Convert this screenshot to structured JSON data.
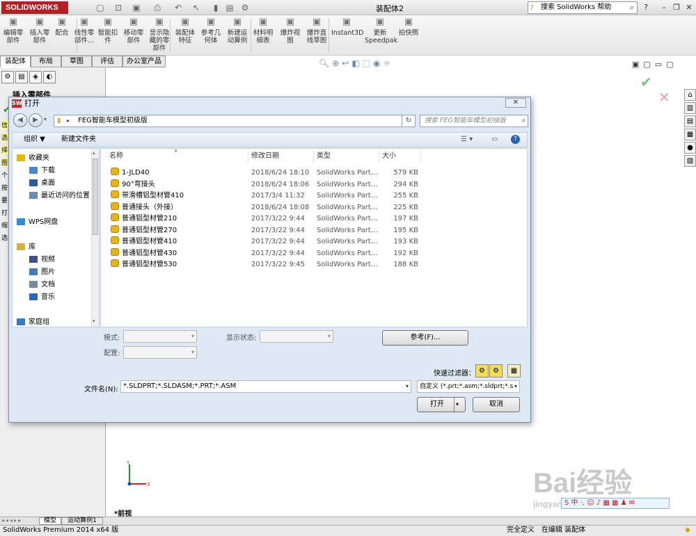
{
  "app": {
    "logo": "SOLIDWORKS",
    "document_title": "装配体2",
    "help_search_placeholder": "搜索 SolidWorks 帮助"
  },
  "ribbon": {
    "buttons": [
      {
        "label": "编辑零\n部件",
        "icon": "edit-component-icon"
      },
      {
        "label": "插入零\n部件",
        "icon": "insert-component-icon"
      },
      {
        "label": "配合",
        "icon": "mate-icon"
      },
      {
        "label": "线性零\n部件...",
        "icon": "linear-pattern-icon"
      },
      {
        "label": "智能扣\n件",
        "icon": "smart-fastener-icon"
      },
      {
        "label": "移动零\n部件",
        "icon": "move-component-icon"
      },
      {
        "label": "显示隐\n藏的零\n部件",
        "icon": "show-hidden-icon"
      },
      {
        "label": "装配体\n特征",
        "icon": "assembly-feature-icon"
      },
      {
        "label": "参考几\n何体",
        "icon": "reference-geometry-icon"
      },
      {
        "label": "新建运\n动算例",
        "icon": "motion-study-icon"
      },
      {
        "label": "材料明\n细表",
        "icon": "bom-icon"
      },
      {
        "label": "爆炸视\n图",
        "icon": "explode-view-icon"
      },
      {
        "label": "爆炸直\n线草图",
        "icon": "explode-line-icon"
      },
      {
        "label": "Instant3D",
        "icon": "instant3d-icon"
      },
      {
        "label": "更新\nSpeedpak",
        "icon": "speedpak-icon"
      },
      {
        "label": "拍快照",
        "icon": "snapshot-icon"
      }
    ]
  },
  "tabs": [
    "装配体",
    "布局",
    "草图",
    "评估",
    "办公室产品"
  ],
  "left_panel": {
    "title": "插入零部件",
    "side_chars": [
      "信",
      "选",
      "择",
      "图",
      "个",
      "按",
      "要",
      "打",
      "缩",
      "选"
    ]
  },
  "dialog": {
    "title": "打开",
    "close": "✕",
    "address": "FEG智能车模型初级版",
    "search_placeholder": "搜索 FEG智能车模型初级版",
    "organize": "组织 ▼",
    "new_folder": "新建文件夹",
    "nav_items": [
      {
        "label": "收藏夹",
        "icon": "star-icon",
        "indent": 0
      },
      {
        "label": "下载",
        "icon": "download-folder-icon",
        "indent": 1
      },
      {
        "label": "桌面",
        "icon": "desktop-icon",
        "indent": 1
      },
      {
        "label": "最近访问的位置",
        "icon": "recent-places-icon",
        "indent": 1
      },
      {
        "label": "WPS网盘",
        "icon": "cloud-icon",
        "indent": 0
      },
      {
        "label": "库",
        "icon": "library-icon",
        "indent": 0
      },
      {
        "label": "视频",
        "icon": "video-icon",
        "indent": 1
      },
      {
        "label": "图片",
        "icon": "picture-icon",
        "indent": 1
      },
      {
        "label": "文档",
        "icon": "document-icon",
        "indent": 1
      },
      {
        "label": "音乐",
        "icon": "music-icon",
        "indent": 1
      },
      {
        "label": "家庭组",
        "icon": "homegroup-icon",
        "indent": 0
      }
    ],
    "columns": [
      "名称",
      "修改日期",
      "类型",
      "大小"
    ],
    "files": [
      {
        "name": "1-JLD40",
        "date": "2018/6/24 18:10",
        "type": "SolidWorks Part...",
        "size": "579 KB"
      },
      {
        "name": "90°弯接头",
        "date": "2018/6/24 18:06",
        "type": "SolidWorks Part...",
        "size": "294 KB"
      },
      {
        "name": "带滑槽铝型材管410",
        "date": "2017/3/4 11:32",
        "type": "SolidWorks Part...",
        "size": "255 KB"
      },
      {
        "name": "普通接头（外接）",
        "date": "2018/6/24 18:08",
        "type": "SolidWorks Part...",
        "size": "225 KB"
      },
      {
        "name": "普通铝型材管210",
        "date": "2017/3/22 9:44",
        "type": "SolidWorks Part...",
        "size": "197 KB"
      },
      {
        "name": "普通铝型材管270",
        "date": "2017/3/22 9:44",
        "type": "SolidWorks Part...",
        "size": "195 KB"
      },
      {
        "name": "普通铝型材管410",
        "date": "2017/3/22 9:44",
        "type": "SolidWorks Part...",
        "size": "193 KB"
      },
      {
        "name": "普通铝型材管430",
        "date": "2017/3/22 9:44",
        "type": "SolidWorks Part...",
        "size": "192 KB"
      },
      {
        "name": "普通铝型材管530",
        "date": "2017/3/22 9:45",
        "type": "SolidWorks Part...",
        "size": "188 KB"
      }
    ],
    "mode_label": "模式:",
    "display_state_label": "显示状态:",
    "config_label": "配置:",
    "reference_button": "参考(F)...",
    "quick_filter_label": "快速过滤器：",
    "filename_label": "文件名(N):",
    "filename_value": "*.SLDPRT;*.SLDASM;*.PRT;*.ASM",
    "filter_value": "自定义 (*.prt;*.asm;*.sldprt;*.s",
    "open_button": "打开",
    "cancel_button": "取消"
  },
  "viewport": {
    "view_label": "*前视"
  },
  "bottom_tabs": [
    "模型",
    "运动算例1"
  ],
  "status": {
    "app_version": "SolidWorks Premium 2014 x64 版",
    "definition": "完全定义",
    "editing": "在编辑 装配体"
  },
  "watermark": {
    "text": "Bai经验",
    "url": "jingyan.baidu.com"
  },
  "colors": {
    "logo_red": "#b31e24",
    "dialog_bg": "#dfe9f5",
    "file_icon_yellow": "#e4b61a",
    "accept_green": "#7fc07f",
    "reject_red": "#e6a0a0"
  }
}
